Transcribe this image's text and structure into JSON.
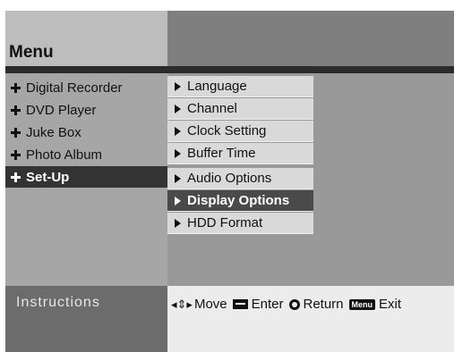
{
  "title": "Menu",
  "main_menu": [
    {
      "label": "Digital Recorder",
      "selected": false
    },
    {
      "label": "DVD Player",
      "selected": false
    },
    {
      "label": "Juke Box",
      "selected": false
    },
    {
      "label": "Photo Album",
      "selected": false
    },
    {
      "label": "Set-Up",
      "selected": true
    }
  ],
  "submenu": [
    {
      "label": "Language",
      "selected": false
    },
    {
      "label": "Channel",
      "selected": false
    },
    {
      "label": "Clock Setting",
      "selected": false
    },
    {
      "label": "Buffer Time",
      "selected": false
    },
    {
      "label": "Audio Options",
      "selected": false
    },
    {
      "label": "Display Options",
      "selected": true
    },
    {
      "label": "HDD Format",
      "selected": false
    }
  ],
  "instructions": {
    "label": "Instructions",
    "move_label": "Move",
    "enter_label": "Enter",
    "return_label": "Return",
    "menu_key_label": "Menu",
    "exit_label": "Exit"
  },
  "icons": {
    "main_item": "plus-icon",
    "sub_item": "arrow-right-icon",
    "move": "four-way-arrow-icon",
    "enter": "enter-key-icon",
    "return": "return-circle-icon"
  }
}
